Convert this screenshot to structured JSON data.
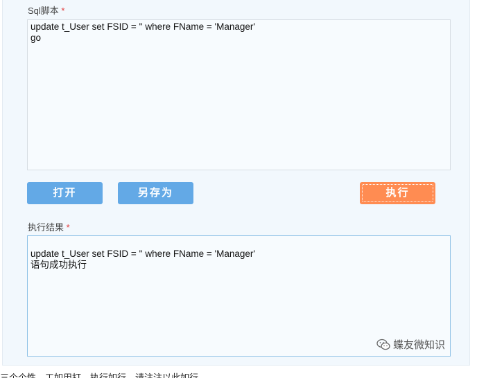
{
  "sql_section": {
    "label": "Sql脚本",
    "required_mark": "*",
    "script_text": "update t_User set FSID = '' where FName = 'Manager'\ngo"
  },
  "buttons": {
    "open_label": "打开",
    "save_as_label": "另存为",
    "execute_label": "执行"
  },
  "result_section": {
    "label": "执行结果",
    "required_mark": "*",
    "result_text": "update t_User set FSID = '' where FName = 'Manager'\n语句成功执行"
  },
  "watermark": {
    "text": "蝶友微知识",
    "icon": "wechat-icon"
  },
  "footer": {
    "text": "三个个性，工如用打，执行如行，请注注以此如行，"
  },
  "colors": {
    "primary_button": "#63a9e6",
    "execute_button": "#ff8c52",
    "required": "#e23b3b",
    "panel_bg": "#f2f8fd"
  }
}
